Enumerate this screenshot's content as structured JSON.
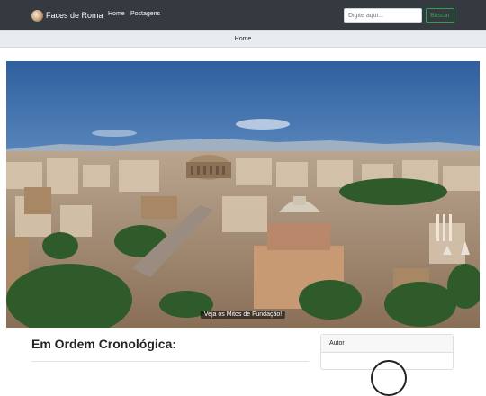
{
  "navbar": {
    "brand": "Faces de Roma",
    "links": [
      "Home",
      "Postagens"
    ],
    "search_placeholder": "Digite aqui...",
    "search_button": "Buscar"
  },
  "breadcrumb": {
    "current": "Home"
  },
  "hero": {
    "caption": "Veja os Mitos de Fundação!"
  },
  "main": {
    "section_title": "Em Ordem Cronológica:"
  },
  "sidebar": {
    "author_header": "Autor"
  },
  "colors": {
    "navbar_bg": "#343a40",
    "search_button": "#28a745",
    "breadcrumb_bg": "#e9ecef"
  },
  "icons": {
    "brand_logo": "roman-coin-icon"
  }
}
